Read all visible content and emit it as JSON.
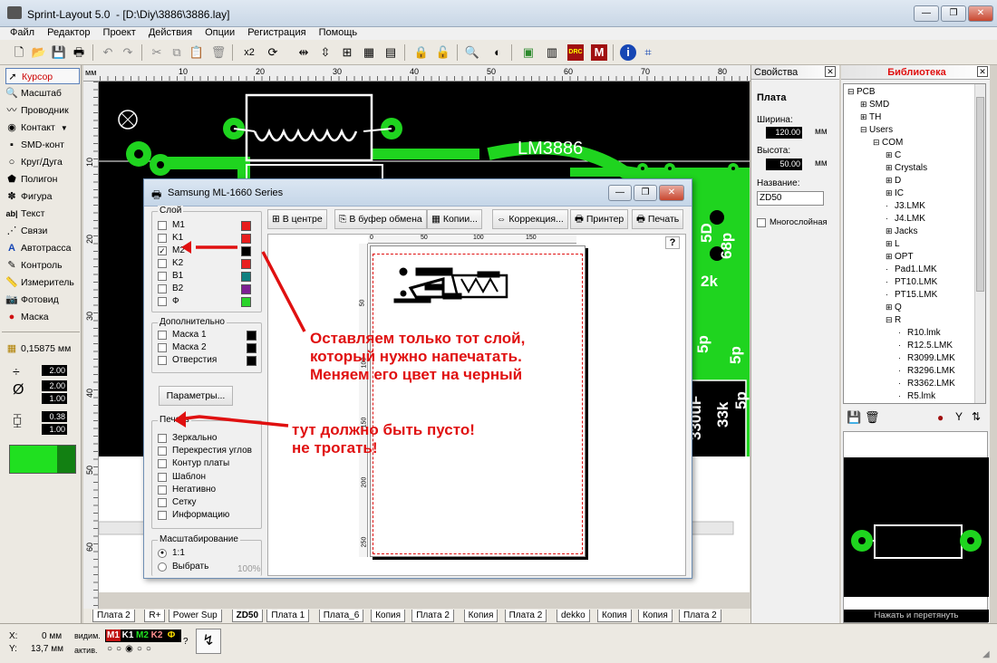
{
  "window": {
    "title": "Sprint-Layout 5.0  - [D:\\Diy\\3886\\3886.lay]",
    "minimize": "—",
    "maximize": "❐",
    "close": "✕"
  },
  "menu": [
    "Файл",
    "Редактор",
    "Проект",
    "Действия",
    "Опции",
    "Регистрация",
    "Помощь"
  ],
  "toolbar": {
    "x2": "x2"
  },
  "tools": [
    {
      "label": "Курсор",
      "icon": "arrow-icon"
    },
    {
      "label": "Масштаб",
      "icon": "magnifier-icon"
    },
    {
      "label": "Проводник",
      "icon": "track-icon"
    },
    {
      "label": "Контакт",
      "icon": "pad-icon"
    },
    {
      "label": "SMD-конт",
      "icon": "smd-pad-icon"
    },
    {
      "label": "Круг/Дуга",
      "icon": "circle-icon"
    },
    {
      "label": "Полигон",
      "icon": "polygon-icon"
    },
    {
      "label": "Фигура",
      "icon": "shape-icon"
    },
    {
      "label": "Текст",
      "icon": "text-icon"
    },
    {
      "label": "Связи",
      "icon": "connections-icon"
    },
    {
      "label": "Автотрасса",
      "icon": "autoroute-icon"
    },
    {
      "label": "Контроль",
      "icon": "test-icon"
    },
    {
      "label": "Измеритель",
      "icon": "measure-icon"
    },
    {
      "label": "Фотовид",
      "icon": "photo-icon"
    },
    {
      "label": "Маска",
      "icon": "mask-icon"
    }
  ],
  "grid": {
    "value": "0,15875 мм"
  },
  "widths": {
    "track": "2.00",
    "pad_outer": "2.00",
    "pad_inner": "1.00",
    "smd_w": "0.38",
    "smd_h": "1.00"
  },
  "ruler": {
    "unit": "мм",
    "top": [
      "10",
      "20",
      "30",
      "40",
      "50",
      "60",
      "70",
      "80"
    ],
    "left": [
      "10",
      "20",
      "30",
      "40",
      "50",
      "60"
    ]
  },
  "canvas": {
    "label": "LM3886",
    "side_labels": [
      "5D",
      "68p",
      "2k",
      "5p",
      "5p",
      "33k",
      "5p",
      "330uF"
    ]
  },
  "properties": {
    "header": "Свойства",
    "section": "Плата",
    "width_label": "Ширина:",
    "width": "120.00",
    "height_label": "Высота:",
    "height": "50.00",
    "unit": "мм",
    "name_label": "Название:",
    "name": "ZD50",
    "multilayer": "Многослойная"
  },
  "library": {
    "header": "Библиотека",
    "tree": [
      {
        "t": "PCB",
        "d": 0,
        "s": "⊟"
      },
      {
        "t": "SMD",
        "d": 1,
        "s": "⊞"
      },
      {
        "t": "TH",
        "d": 1,
        "s": "⊞"
      },
      {
        "t": "Users",
        "d": 1,
        "s": "⊟"
      },
      {
        "t": "COM",
        "d": 2,
        "s": "⊟"
      },
      {
        "t": "C",
        "d": 3,
        "s": "⊞"
      },
      {
        "t": "Crystals",
        "d": 3,
        "s": "⊞"
      },
      {
        "t": "D",
        "d": 3,
        "s": "⊞"
      },
      {
        "t": "IC",
        "d": 3,
        "s": "⊞"
      },
      {
        "t": "J3.LMK",
        "d": 3,
        "s": ""
      },
      {
        "t": "J4.LMK",
        "d": 3,
        "s": ""
      },
      {
        "t": "Jacks",
        "d": 3,
        "s": "⊞"
      },
      {
        "t": "L",
        "d": 3,
        "s": "⊞"
      },
      {
        "t": "OPT",
        "d": 3,
        "s": "⊞"
      },
      {
        "t": "Pad1.LMK",
        "d": 3,
        "s": ""
      },
      {
        "t": "PT10.LMK",
        "d": 3,
        "s": ""
      },
      {
        "t": "PT15.LMK",
        "d": 3,
        "s": ""
      },
      {
        "t": "Q",
        "d": 3,
        "s": "⊞"
      },
      {
        "t": "R",
        "d": 3,
        "s": "⊟"
      },
      {
        "t": "R10.lmk",
        "d": 4,
        "s": ""
      },
      {
        "t": "R12.5.LMK",
        "d": 4,
        "s": ""
      },
      {
        "t": "R3099.LMK",
        "d": 4,
        "s": ""
      },
      {
        "t": "R3296.LMK",
        "d": 4,
        "s": ""
      },
      {
        "t": "R3362.LMK",
        "d": 4,
        "s": ""
      },
      {
        "t": "R5.lmk",
        "d": 4,
        "s": ""
      }
    ],
    "drag_hint": "Нажать и перетянуть"
  },
  "dialog": {
    "title": "Samsung ML-1660 Series",
    "buttons": [
      "В центре",
      "В буфер обмена",
      "Копии...",
      "Коррекция...",
      "Принтер",
      "Печать"
    ],
    "layers_label": "Слой",
    "layers": [
      {
        "n": "M1",
        "c": "#e81e1e",
        "on": false
      },
      {
        "n": "K1",
        "c": "#e81e1e",
        "on": false
      },
      {
        "n": "M2",
        "c": "#000000",
        "on": true
      },
      {
        "n": "K2",
        "c": "#e81e1e",
        "on": false
      },
      {
        "n": "B1",
        "c": "#0f8080",
        "on": false
      },
      {
        "n": "B2",
        "c": "#7e1f94",
        "on": false
      },
      {
        "n": "Ф",
        "c": "#2bd42b",
        "on": false
      }
    ],
    "extra_label": "Дополнительно",
    "extra": [
      "Маска 1",
      "Маска 2",
      "Отверстия"
    ],
    "params_button": "Параметры...",
    "print_label": "Печать",
    "print_opts": [
      "Зеркально",
      "Перекрестия углов",
      "Контур платы",
      "Шаблон",
      "Негативно",
      "Сетку",
      "Информацию"
    ],
    "scale_label": "Масштабирование",
    "scale_1": "1:1",
    "scale_sel": "Выбрать",
    "scale_pct": "100%",
    "ruler_top": [
      "0",
      "50",
      "100",
      "150"
    ],
    "ruler_left": [
      "50",
      "100",
      "150",
      "200",
      "250"
    ],
    "help": "?"
  },
  "annotations": {
    "a1": [
      "Оставляем только тот слой,",
      "который нужно напечатать.",
      "Меняем его цвет на черный"
    ],
    "a2": [
      "тут должно быть пусто!",
      "не трогать!"
    ]
  },
  "tabs": [
    "Плата 2",
    "R+",
    "Power Sup",
    "ZD50",
    "Плата 1",
    "Плата_6",
    "Копия",
    "Плата 2",
    "Копия",
    "Плата 2",
    "dekko",
    "Копия",
    "Копия",
    "Плата 2"
  ],
  "status": {
    "x_label": "X:",
    "x": "0 мм",
    "y_label": "Y:",
    "y": "13,7 мм",
    "vis_label": "видим.",
    "act_label": "актив.",
    "layers": [
      "M1",
      "K1",
      "M2",
      "K2",
      "Ф"
    ],
    "help": "?"
  }
}
